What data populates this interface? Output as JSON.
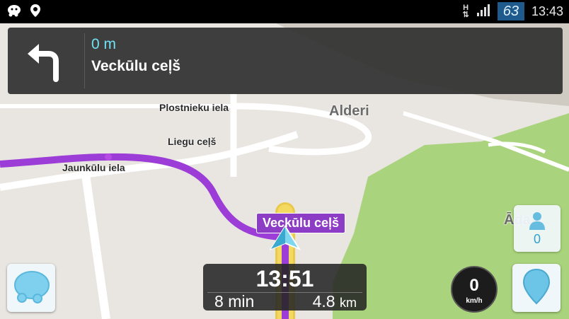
{
  "status_bar": {
    "signal_type": "H",
    "battery": "63",
    "time": "13:43"
  },
  "navigation": {
    "distance": "0 m",
    "street": "Veckūlu ceļš"
  },
  "map_labels": {
    "plostnieku": "Plostnieku iela",
    "alderi": "Alderi",
    "liegu": "Liegu ceļš",
    "jaunkulu": "Jaunkūlu iela",
    "adazi_partial": "Ādaži"
  },
  "current_street_badge": "Veckūlu ceļš",
  "eta": {
    "arrival_time": "13:51",
    "duration_value": "8",
    "duration_unit": "min",
    "distance_value": "4.8",
    "distance_unit": "km"
  },
  "speedometer": {
    "speed": "0",
    "unit": "km/h"
  },
  "nearby_wazers": {
    "count": "0"
  },
  "colors": {
    "route": "#9b3dd6",
    "park": "#a9d37c",
    "accent": "#2fa3d0"
  }
}
